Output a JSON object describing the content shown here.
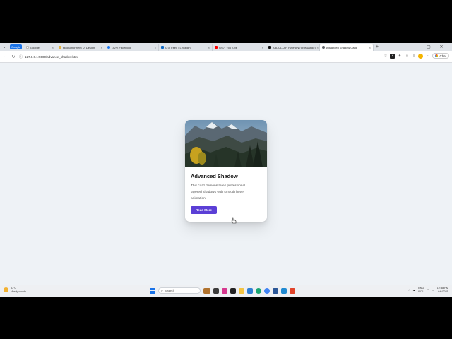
{
  "tabs": [
    {
      "label": "Google",
      "fav": "#ffffff",
      "active": false
    },
    {
      "label": "tiktorumorthem UI Design",
      "fav": "#e3b341",
      "active": false
    },
    {
      "label": "(32+) Facebook",
      "fav": "#1877f2",
      "active": false
    },
    {
      "label": "(27) Feed | LinkedIn",
      "fav": "#0a66c2",
      "active": false
    },
    {
      "label": "(267) YouTube",
      "fav": "#ff0000",
      "active": false
    },
    {
      "label": "ABDULLAH RAIHAN (@realabqo)",
      "fav": "#111111",
      "active": false
    },
    {
      "label": "Advanced Shadow Card",
      "fav": "#5f6368",
      "active": true
    }
  ],
  "google_button": "Google",
  "address": {
    "url": "127.0.0.1:5500/advance_shadow.html"
  },
  "chat_label": "Chat",
  "card": {
    "title": "Advanced Shadow",
    "text": "This card demonstrates professional layered shadows with smooth hover animation.",
    "button": "Read More"
  },
  "taskbar": {
    "weather_temp": "37°C",
    "weather_desc": "Mostly cloudy",
    "search_placeholder": "Search",
    "lang_top": "ENG",
    "lang_bottom": "INTL",
    "time": "12:38 PM",
    "date": "6/6/2025"
  },
  "colors": {
    "accent": "#5b3fd6",
    "page_bg": "#eef2f6"
  }
}
